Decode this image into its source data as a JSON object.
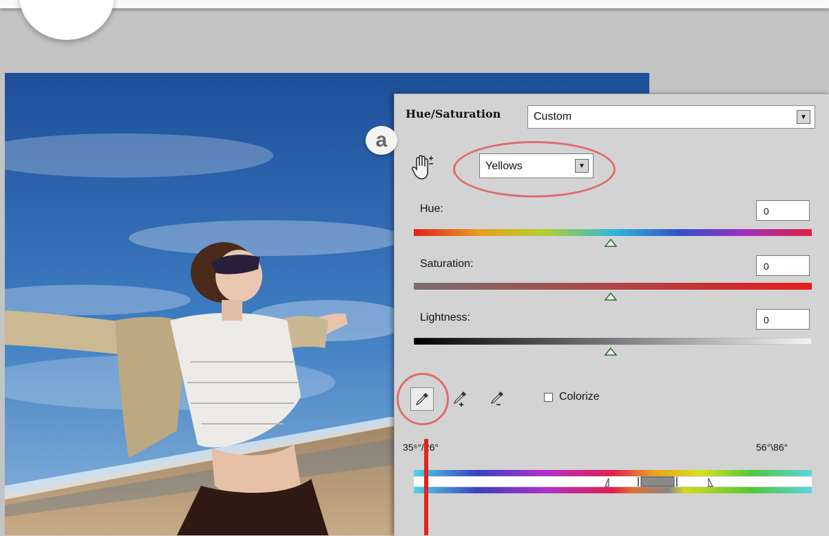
{
  "panel": {
    "title": "Hue/Saturation",
    "preset_value": "Custom",
    "channel_value": "Yellows",
    "hue": {
      "label": "Hue:",
      "value": "0"
    },
    "saturation": {
      "label": "Saturation:",
      "value": "0"
    },
    "lightness": {
      "label": "Lightness:",
      "value": "0"
    },
    "colorize_label": "Colorize",
    "range_left": "35⁶°/26°",
    "range_right": "56°\\86°"
  },
  "annotation": {
    "marker": "a"
  },
  "icons": {
    "hand": "targeted-adjustment-hand-icon",
    "eyedropper": "eyedropper-icon",
    "eyedropper_add": "eyedropper-plus-icon",
    "eyedropper_subtract": "eyedropper-minus-icon",
    "dropdown": "chevron-down-icon"
  },
  "colors": {
    "highlight_ring": "#e06a6a",
    "arrow_line": "#e32222",
    "panel_bg": "#d3d3d3"
  }
}
